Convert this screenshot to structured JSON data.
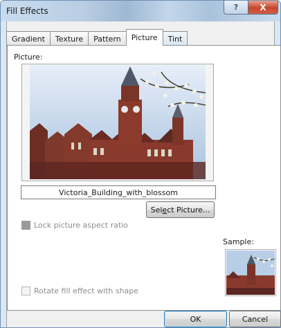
{
  "window": {
    "title": "Fill Effects",
    "help_label": "?",
    "close_label": "X"
  },
  "tabs": [
    {
      "label": "Gradient",
      "selected": false
    },
    {
      "label": "Texture",
      "selected": false
    },
    {
      "label": "Pattern",
      "selected": false
    },
    {
      "label": "Picture",
      "selected": true
    },
    {
      "label": "Tint",
      "selected": false
    }
  ],
  "picture": {
    "section_label": "Picture:",
    "filename": "Victoria_Building_with_blossom",
    "select_button": {
      "pre": "Sel",
      "accel": "e",
      "post": "ct Picture..."
    }
  },
  "options": {
    "lock_aspect": {
      "label": "Lock picture aspect ratio",
      "checked": false,
      "enabled": false
    },
    "rotate_fill": {
      "label": "Rotate fill effect with shape",
      "checked": false,
      "enabled": false
    }
  },
  "sample": {
    "label": "Sample:"
  },
  "footer": {
    "ok_label": "OK",
    "cancel_label": "Cancel"
  },
  "colors": {
    "brick": "#8a3a2c",
    "sky": "#c9dcef",
    "titlebar": "#c9dcef",
    "close": "#c7452c"
  },
  "icons": {
    "help": "question-mark",
    "close": "x-mark"
  }
}
